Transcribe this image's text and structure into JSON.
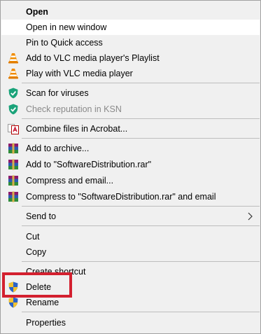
{
  "context_menu": {
    "items": [
      {
        "label": "Open"
      },
      {
        "label": "Open in new window"
      },
      {
        "label": "Pin to Quick access"
      },
      {
        "label": "Add to VLC media player's Playlist",
        "icon": "vlc-cone-icon"
      },
      {
        "label": "Play with VLC media player",
        "icon": "vlc-cone-icon"
      },
      {
        "label": "Scan for viruses",
        "icon": "kaspersky-shield-icon"
      },
      {
        "label": "Check reputation in KSN",
        "icon": "kaspersky-shield-icon"
      },
      {
        "label": "Combine files in Acrobat...",
        "icon": "acrobat-combine-icon"
      },
      {
        "label": "Add to archive...",
        "icon": "winrar-icon"
      },
      {
        "label": "Add to \"SoftwareDistribution.rar\"",
        "icon": "winrar-icon"
      },
      {
        "label": "Compress and email...",
        "icon": "winrar-icon"
      },
      {
        "label": "Compress to \"SoftwareDistribution.rar\" and email",
        "icon": "winrar-icon"
      },
      {
        "label": "Send to",
        "icon": "chevron-right-icon"
      },
      {
        "label": "Cut"
      },
      {
        "label": "Copy"
      },
      {
        "label": "Create shortcut"
      },
      {
        "label": "Delete",
        "icon": "uac-shield-icon"
      },
      {
        "label": "Rename",
        "icon": "uac-shield-icon"
      },
      {
        "label": "Properties"
      }
    ]
  },
  "colors": {
    "menu_bg": "#f0f0f0",
    "hover_bg": "#ffffff",
    "highlight_box": "#d3202f",
    "disabled_text": "#8a8a8a",
    "kaspersky_green": "#1aa37a",
    "vlc_orange": "#f08c00"
  }
}
